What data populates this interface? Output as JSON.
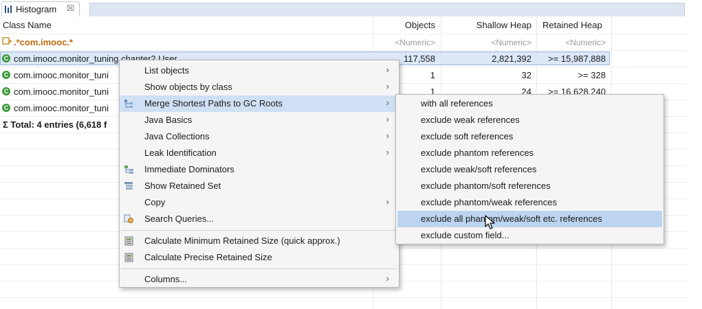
{
  "tab": {
    "label": "Histogram",
    "close": "☒"
  },
  "columns": [
    "Class Name",
    "Objects",
    "Shallow Heap",
    "Retained Heap"
  ],
  "filter": {
    "regex": ".*com.imooc.*",
    "objects": "<Numeric>",
    "shallow": "<Numeric>",
    "retained": "<Numeric>"
  },
  "rows": [
    {
      "name": "com.imooc.monitor_tuning.chapter2.User",
      "objects": "117,558",
      "shallow": "2,821,392",
      "retained": ">= 15,987,888"
    },
    {
      "name": "com.imooc.monitor_tuni",
      "objects": "1",
      "shallow": "32",
      "retained": ">= 328"
    },
    {
      "name": "com.imooc.monitor_tuni",
      "objects": "1",
      "shallow": "24",
      "retained": ">= 16,628,240"
    },
    {
      "name": "com.imooc.monitor_tuni",
      "objects": "",
      "shallow": "",
      "retained": ""
    }
  ],
  "total": "Σ Total: 4 entries (6,618 f",
  "menu": {
    "items": [
      {
        "label": "List objects",
        "arrow": "›"
      },
      {
        "label": "Show objects by class",
        "arrow": "›"
      },
      {
        "label": "Merge Shortest Paths to GC Roots",
        "arrow": "›"
      },
      {
        "label": "Java Basics",
        "arrow": "›"
      },
      {
        "label": "Java Collections",
        "arrow": "›"
      },
      {
        "label": "Leak Identification",
        "arrow": "›"
      },
      {
        "label": "Immediate Dominators",
        "arrow": ""
      },
      {
        "label": "Show Retained Set",
        "arrow": ""
      },
      {
        "label": "Copy",
        "arrow": "›"
      },
      {
        "label": "Search Queries...",
        "arrow": ""
      },
      {
        "label": "Calculate Minimum Retained Size (quick approx.)",
        "arrow": ""
      },
      {
        "label": "Calculate Precise Retained Size",
        "arrow": ""
      },
      {
        "label": "Columns...",
        "arrow": "›"
      }
    ]
  },
  "submenu": {
    "items": [
      "with all references",
      "exclude weak references",
      "exclude soft references",
      "exclude phantom references",
      "exclude weak/soft references",
      "exclude phantom/soft references",
      "exclude phantom/weak references",
      "exclude all phantom/weak/soft etc. references",
      "exclude custom field..."
    ]
  },
  "colors": {
    "highlight": "#cfe0f5",
    "submenu_highlight": "#bcd4f0",
    "class_icon": "#3d9a3d",
    "tab_strip": "#dde6f2"
  }
}
